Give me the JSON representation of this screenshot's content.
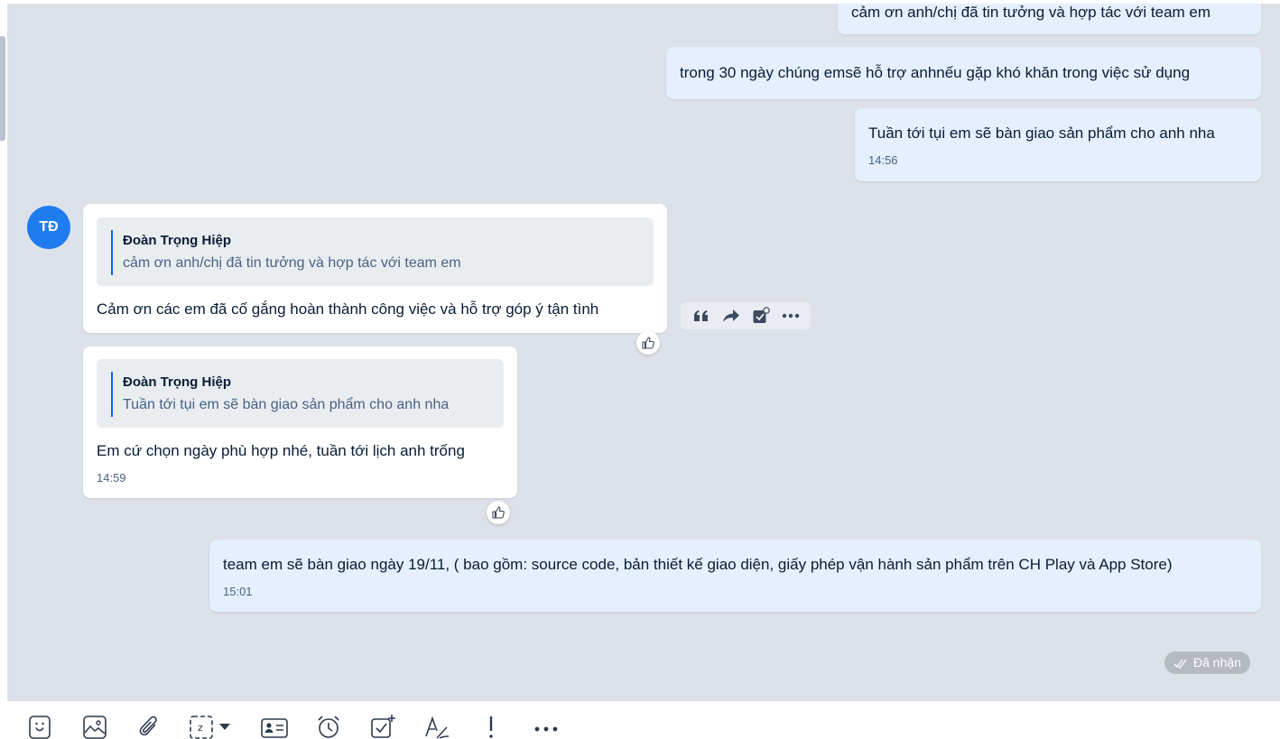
{
  "messages": {
    "m1": {
      "text": "cảm ơn anh/chị đã tin tưởng và hợp tác với team em"
    },
    "m2": {
      "text": "trong 30 ngày chúng emsẽ hỗ trợ anhnếu gặp khó khăn trong việc sử dụng"
    },
    "m3": {
      "text": "Tuần tới tụi em sẽ bàn giao sản phẩm cho anh nha",
      "time": "14:56"
    },
    "m4": {
      "quote_author": "Đoàn Trọng Hiệp",
      "quote_text": "cảm ơn anh/chị đã tin tưởng và hợp tác với team em",
      "text": "Cảm ơn các em đã cố gắng hoàn thành công việc và hỗ trợ góp ý tận tình"
    },
    "m5": {
      "quote_author": "Đoàn Trọng Hiệp",
      "quote_text": "Tuần tới tụi em sẽ bàn giao sản phẩm cho anh nha",
      "text": "Em cứ chọn ngày phù hợp nhé, tuần tới lịch anh trống",
      "time": "14:59"
    },
    "m6": {
      "text": "team em sẽ bàn giao ngày 19/11, ( bao gồm: source code, bản thiết kế giao diện, giấy phép vận hành sản phẩm trên CH Play và App Store)",
      "time": "15:01"
    }
  },
  "avatar": {
    "initials": "TĐ",
    "color": "#1f7cf0"
  },
  "status": {
    "label": "Đã nhận"
  },
  "colors": {
    "my_bubble": "#e5efff",
    "their_bubble": "#ffffff",
    "accent": "#0068ff",
    "background": "#dde2ea"
  },
  "hover_actions": [
    "quote-icon",
    "forward-icon",
    "add-task-icon",
    "more-icon"
  ],
  "toolbar_icons": [
    "sticker-icon",
    "image-icon",
    "attachment-icon",
    "screenshot-icon",
    "contact-card-icon",
    "reminder-icon",
    "task-icon",
    "format-icon",
    "urgent-icon",
    "more-icon"
  ]
}
